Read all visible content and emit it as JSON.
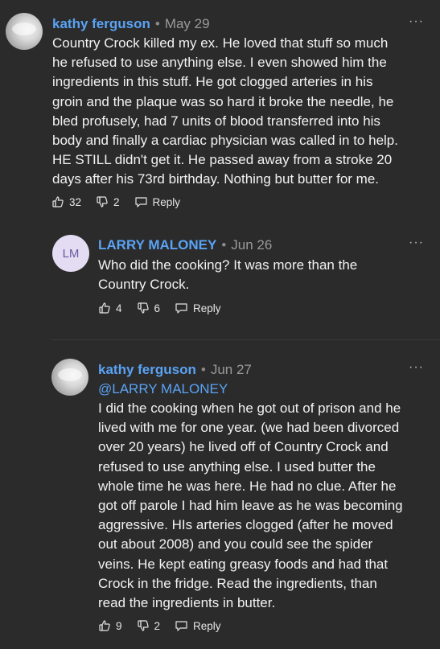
{
  "comments": [
    {
      "author": "kathy ferguson",
      "date": "May 29",
      "avatar": "photo",
      "text": "Country Crock killed my ex.  He loved that stuff so much\nhe refused to use anything else.  I even showed him the\ningredients in this stuff.  He got clogged arteries in his\ngroin and the plaque was so hard it broke the needle, he\nbled profusely, had 7 units of blood transferred into his\nbody and finally a cardiac physician was called in to help.\nHE STILL didn't get it.  He passed away from a stroke 20\ndays after his 73rd birthday.  Nothing but butter for me.",
      "likes": "32",
      "dislikes": "2",
      "reply_label": "Reply",
      "more": "···"
    },
    {
      "author": "LARRY MALONEY",
      "date": "Jun 26",
      "avatar_initials": "LM",
      "text": "Who did the cooking? It was more than the\nCountry Crock.",
      "likes": "4",
      "dislikes": "6",
      "reply_label": "Reply",
      "more": "···"
    },
    {
      "author": "kathy ferguson",
      "date": "Jun 27",
      "avatar": "photo",
      "mention": "@LARRY MALONEY",
      "text": "I did the cooking when he got out of prison and he\nlived with me for one year. (we had been divorced\nover 20 years)  he lived off of Country Crock and\nrefused to use anything else.  I used butter the\nwhole time he was here. He had no clue. After he\ngot off parole I had him leave as he was becoming\naggressive. HIs arteries clogged (after he moved\nout about 2008) and you could see the spider\nveins.  He kept eating greasy foods and had that\nCrock in the fridge.  Read the ingredients, than\nread the ingredients in butter.",
      "likes": "9",
      "dislikes": "2",
      "reply_label": "Reply",
      "more": "···"
    }
  ],
  "icons": {
    "like": "thumbs-up-icon",
    "dislike": "thumbs-down-icon",
    "reply": "speech-bubble-icon",
    "more": "more-options-icon"
  },
  "colors": {
    "background": "#2b2b2b",
    "author": "#5aa3f5",
    "text": "#f2f2f2",
    "muted": "#9a9a9a",
    "avatar_initials_bg": "#e4dcf2",
    "avatar_initials_fg": "#6b5aa0"
  }
}
